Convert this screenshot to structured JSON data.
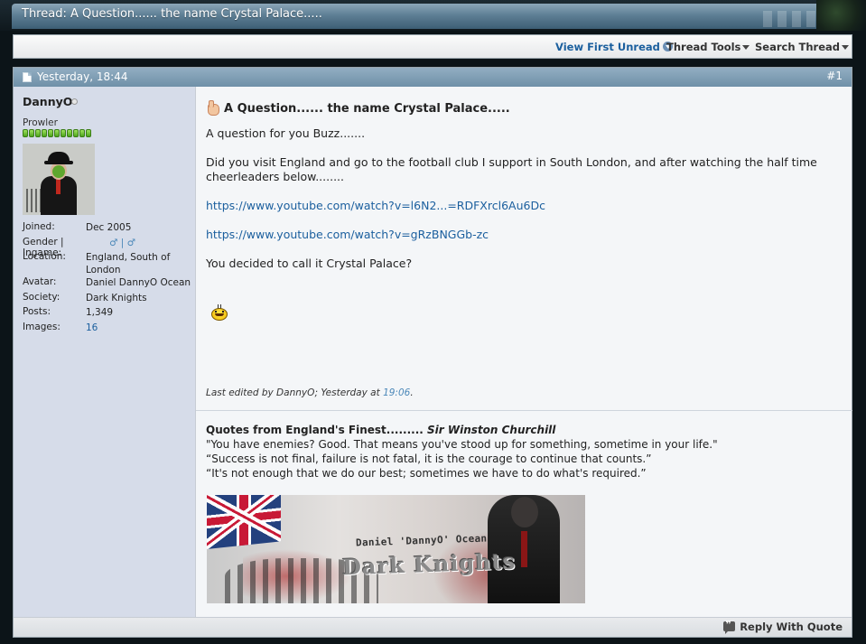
{
  "window": {
    "thread_title": "Thread: A Question...... the name Crystal Palace....."
  },
  "toolbar": {
    "view_first_unread": "View First Unread",
    "thread_tools": "Thread Tools",
    "search_thread": "Search Thread"
  },
  "post": {
    "date": "Yesterday, 18:44",
    "number": "#1",
    "title": "A Question...... the name Crystal Palace.....",
    "paragraphs": [
      "A question for you Buzz.......",
      "Did you visit England and go to the football club I support in South London, and after watching the half time cheerleaders below........"
    ],
    "links": [
      "https://www.youtube.com/watch?v=l6N2...=RDFXrcl6Au6Dc",
      "https://www.youtube.com/watch?v=gRzBNGGb-zc"
    ],
    "closing": "You decided to call it Crystal Palace?",
    "last_edited_prefix": "Last edited by DannyO; Yesterday at ",
    "last_edited_time": "19:06",
    "last_edited_suffix": "."
  },
  "user": {
    "name": "DannyO",
    "title": "Prowler",
    "reputation_pips": 11,
    "details": {
      "joined_label": "Joined:",
      "joined": "Dec 2005",
      "gender_label": "Gender | Ingame:",
      "gender": "♂ | ♂",
      "location_label": "Location:",
      "location": "England, South of London",
      "avatar_label": "Avatar:",
      "avatar": "Daniel DannyO Ocean",
      "society_label": "Society:",
      "society": "Dark Knights",
      "posts_label": "Posts:",
      "posts": "1,349",
      "images_label": "Images:",
      "images": "16"
    }
  },
  "signature": {
    "heading": "Quotes from England's Finest.........",
    "heading_author": "Sir Winston Churchill",
    "quotes": [
      "\"You have enemies? Good. That means you've stood up for something, sometime in your life.\"",
      "“Success is not final, failure is not fatal, it is the courage to continue that counts.”",
      "“It's not enough that we do our best; sometimes we have to do what's required.”"
    ],
    "banner_subtitle": "Daniel 'DannyO' Ocean",
    "banner_title": "Dark Knights"
  },
  "footer": {
    "reply_with_quote": "Reply With Quote"
  },
  "icons": {
    "post": "document-icon",
    "title_icon": "hand-icon",
    "smiley": "smiley-icon",
    "quote": "quote-bubble-icon",
    "dropdown": "chevron-down-icon"
  },
  "colors": {
    "header_blue": "#7f9db3",
    "link_blue": "#1b5f9e",
    "userinfo_bg": "#d6dce9",
    "reputation_green": "#4ea51c"
  }
}
